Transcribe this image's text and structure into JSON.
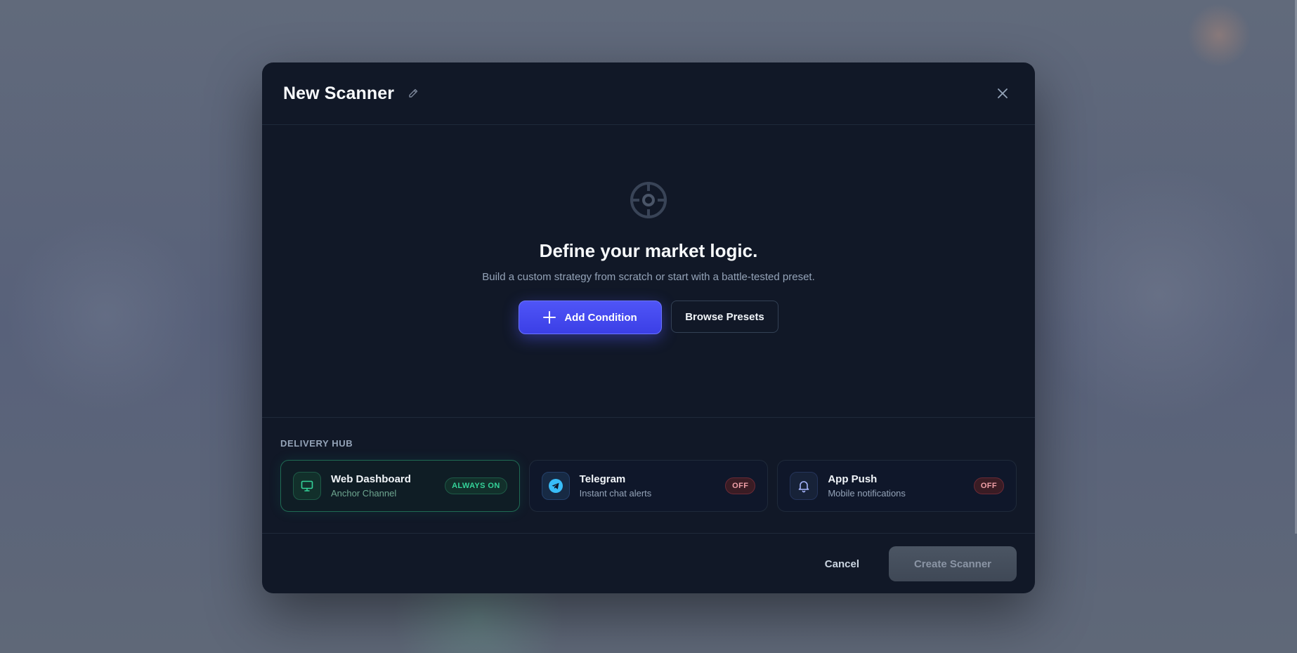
{
  "modal": {
    "title": "New Scanner"
  },
  "empty_state": {
    "headline": "Define your market logic.",
    "subtitle": "Build a custom strategy from scratch or start with a battle-tested preset.",
    "add_condition_label": "Add Condition",
    "browse_presets_label": "Browse Presets"
  },
  "delivery_hub": {
    "label": "DELIVERY HUB",
    "channels": [
      {
        "name": "Web Dashboard",
        "description": "Anchor Channel",
        "status": "ALWAYS ON",
        "icon": "monitor-icon"
      },
      {
        "name": "Telegram",
        "description": "Instant chat alerts",
        "status": "OFF",
        "icon": "telegram-icon"
      },
      {
        "name": "App Push",
        "description": "Mobile notifications",
        "status": "OFF",
        "icon": "bell-icon"
      }
    ]
  },
  "footer": {
    "cancel_label": "Cancel",
    "create_label": "Create Scanner"
  },
  "colors": {
    "accent": "#4f55f7",
    "success": "#34d399",
    "danger": "#f0a0a8",
    "surface": "#111827"
  }
}
